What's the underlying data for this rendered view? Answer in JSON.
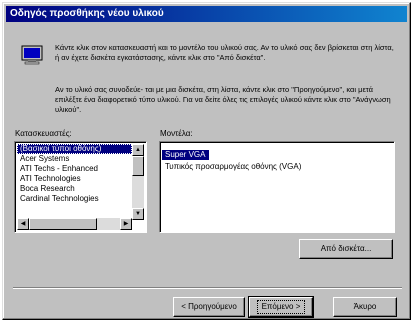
{
  "window": {
    "title": "Οδηγός προσθήκης νέου υλικού"
  },
  "icons": {
    "header": "monitor-icon"
  },
  "instructions": {
    "para1": "Κάντε κλικ στον κατασκευαστή και το μοντέλο του υλικού σας. Αν το υλικό σας δεν βρίσκεται στη λίστα, ή αν έχετε δισκέτα εγκατάστασης, κάντε κλικ στο \"Από δισκέτα\".",
    "para2": "Αν το υλικό σας συνοδεύε- ται με μια δισκέτα, στη λίστα, κάντε κλικ στο \"Προηγούμενο\", και μετά επιλέξτε ένα διαφορετικό τύπο υλικού. Για να δείτε όλες τις επιλογές υλικού κάντε κλικ στο \"Ανάγνωση υλικού\"."
  },
  "manufacturers": {
    "label": "Κατασκευαστές:",
    "items": [
      "(Βασικοί τύποι οθόνης)",
      "Acer Systems",
      "ATI Techs - Enhanced",
      "ATI Technologies",
      "Boca Research",
      "Cardinal Technologies"
    ],
    "selected_index": 0
  },
  "models": {
    "label": "Μοντέλα:",
    "items": [
      "Super VGA",
      "Τυπικός προσαρμογέας οθόνης (VGA)"
    ],
    "selected_index": 0
  },
  "buttons": {
    "have_disk": "Από δισκέτα...",
    "back": "< Προηγούμενο",
    "next": "Επόμενο >",
    "cancel": "Άκυρο"
  }
}
